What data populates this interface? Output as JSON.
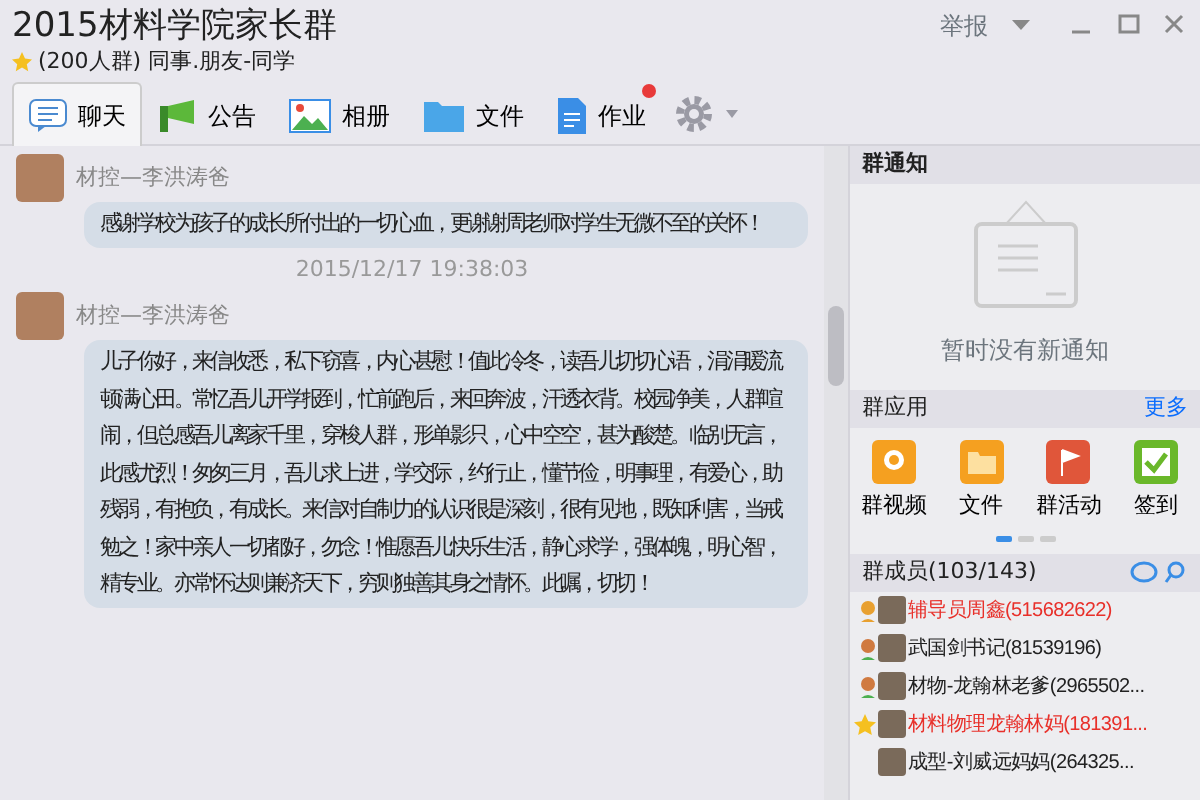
{
  "window": {
    "title": "2015材料学院家长群",
    "subtitle": "(200人群) 同事.朋友-同学",
    "report": "举报"
  },
  "tabs": [
    {
      "label": "聊天",
      "selected": true,
      "notification": false
    },
    {
      "label": "公告",
      "selected": false,
      "notification": false
    },
    {
      "label": "相册",
      "selected": false,
      "notification": false
    },
    {
      "label": "文件",
      "selected": false,
      "notification": false
    },
    {
      "label": "作业",
      "selected": false,
      "notification": true
    }
  ],
  "messages": [
    {
      "kind": "message",
      "sender": "材控—李洪涛爸",
      "text": "感谢学校为孩子的成长所付出的一切心血，更谢谢周老师对学生无微不至的关怀！"
    },
    {
      "kind": "time",
      "text": "2015/12/17 19:38:03"
    },
    {
      "kind": "message",
      "sender": "材控—李洪涛爸",
      "text": "儿子你好，来信收悉，私下窃喜，内心甚慰！值此冷冬，读吾儿切切心语，涓涓暖流顿满心田。常忆吾儿开学报到，忙前跑后，来回奔波，汗透衣背。校园净美，人群喧闹，但总感吾儿离家千里，穿梭人群，形单影只，心中空空，甚为酸楚。临别无言，此感尤烈！匆匆三月，吾儿求上进，学交际，约行止，懂节俭，明事理，有爱心，助残弱，有抱负，有成长。来信对自制力的认识很是深刻，很有见地，既知利害，当戒勉之！家中亲人一切都好，勿念！惟愿吾儿快乐生活，静心求学，强体魄，明心智，精专业。亦常怀达则兼济天下，穷则独善其身之情怀。此嘱，切切！"
    }
  ],
  "notice": {
    "title": "群通知",
    "empty": "暂时没有新通知"
  },
  "apps": {
    "title": "群应用",
    "more": "更多",
    "items": [
      {
        "label": "群视频"
      },
      {
        "label": "文件"
      },
      {
        "label": "群活动"
      },
      {
        "label": "签到"
      }
    ],
    "pages": [
      {
        "selected": true
      },
      {
        "selected": false
      },
      {
        "selected": false
      }
    ]
  },
  "members": {
    "title": "群成员(103/143)",
    "items": [
      {
        "name": "辅导员周鑫(515682622)",
        "kind": "owner",
        "color": "#e8302a"
      },
      {
        "name": "武国剑书记(81539196)",
        "kind": "admin",
        "color": "#222222"
      },
      {
        "name": "材物-龙翰林老爹(2965502...",
        "kind": "admin",
        "color": "#222222"
      },
      {
        "name": "材料物理龙翰林妈(181391...",
        "kind": "vip",
        "color": "#e8302a"
      },
      {
        "name": "成型-刘威远妈妈(264325...",
        "kind": "member",
        "color": "#222222"
      }
    ]
  }
}
